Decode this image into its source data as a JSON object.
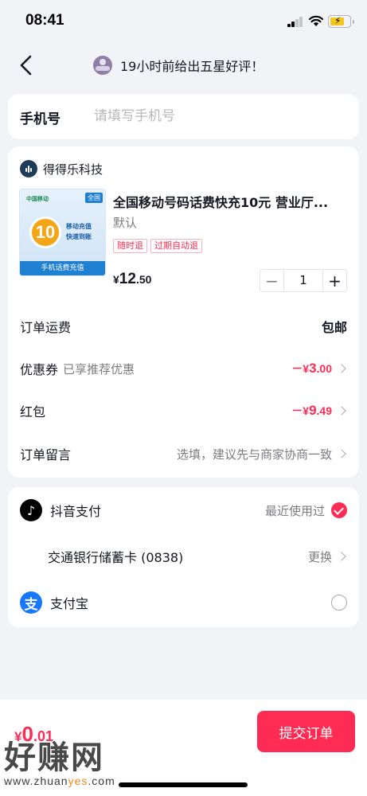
{
  "status_bar": {
    "time": "08:41"
  },
  "nav": {
    "title": "19小时前给出五星好评！"
  },
  "phone": {
    "label": "手机号",
    "placeholder": "请填写手机号"
  },
  "shop": {
    "name": "得得乐科技"
  },
  "product": {
    "title": "全国移动号码话费快充10元 营业厅...",
    "spec": "默认",
    "tags": [
      "随时退",
      "过期自动退"
    ],
    "price_symbol": "¥",
    "price_int": "12",
    "price_dec": ".50",
    "quantity": "1",
    "image_text": {
      "logo": "中国移动",
      "corner": "全国",
      "coin": "10",
      "line1": "移动充值",
      "line2": "快速到账",
      "bottom": "手机话费充值"
    }
  },
  "rows": {
    "shipping": {
      "label": "订单运费",
      "value": "包邮"
    },
    "coupon": {
      "label": "优惠券",
      "sub": "已享推荐优惠",
      "value_sign": "－¥",
      "value_int": "3",
      "value_dec": ".00"
    },
    "redpacket": {
      "label": "红包",
      "value_sign": "－¥",
      "value_int": "9",
      "value_dec": ".49"
    },
    "message": {
      "label": "订单留言",
      "hint": "选填，建议先与商家协商一致"
    }
  },
  "payment": {
    "douyin": {
      "label": "抖音支付",
      "hint": "最近使用过"
    },
    "bank": {
      "label": "交通银行储蓄卡 (0838)",
      "action": "更换"
    },
    "alipay": {
      "label": "支付宝"
    }
  },
  "footer": {
    "total_symbol": "¥",
    "total_int": "0",
    "total_dec": ".01",
    "submit_label": "提交订单",
    "watermark_big": "好赚网",
    "watermark_small_a": "www.zhuan",
    "watermark_small_b": "yes",
    "watermark_small_c": ".com"
  },
  "colors": {
    "accent": "#fe2c55",
    "text": "#161823",
    "muted": "#7b7c80",
    "background": "#f2f3f7"
  }
}
